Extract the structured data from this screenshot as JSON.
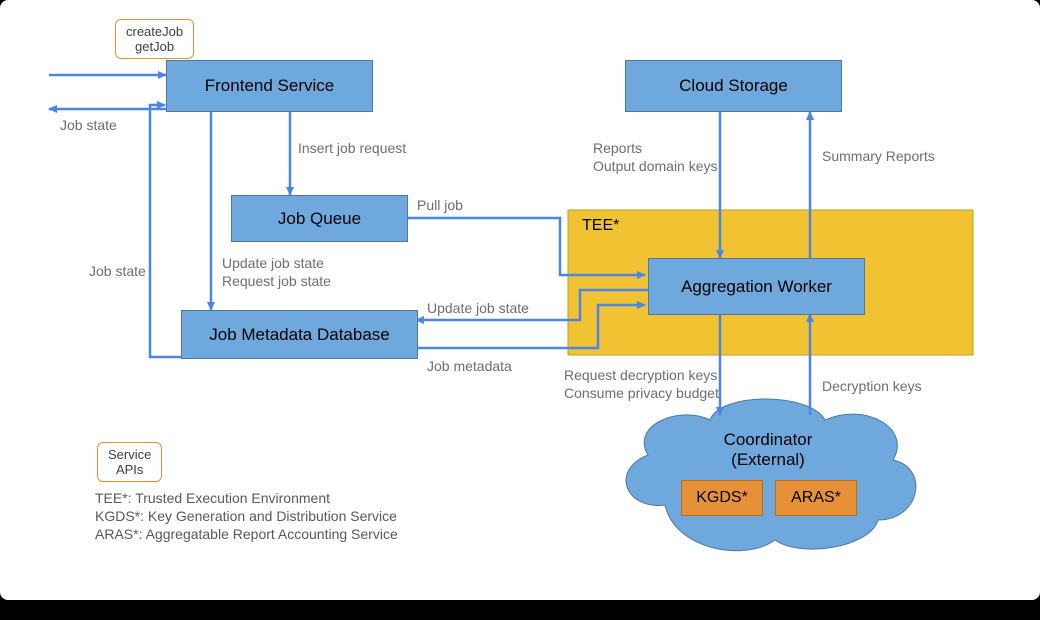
{
  "api_labels": {
    "top": {
      "line1": "createJob",
      "line2": "getJob"
    },
    "legend": {
      "line1": "Service",
      "line2": "APIs"
    }
  },
  "boxes": {
    "frontend": "Frontend Service",
    "cloud": "Cloud Storage",
    "queue": "Job Queue",
    "metadata": "Job Metadata Database",
    "worker": "Aggregation Worker",
    "tee": "TEE*"
  },
  "coordinator": {
    "title1": "Coordinator",
    "title2": "(External)",
    "kgds": "KGDS*",
    "aras": "ARAS*"
  },
  "labels": {
    "job_state_left": "Job state",
    "job_state_top": "Job state",
    "insert_job": "Insert job request",
    "pull_job": "Pull job",
    "update_and_request1": "Update job state",
    "update_and_request2": "Request job state",
    "update_job_state_right": "Update job state",
    "job_metadata": "Job metadata",
    "reports1": "Reports",
    "reports2": "Output domain keys",
    "summary": "Summary Reports",
    "request_keys1": "Request decryption keys",
    "request_keys2": "Consume privacy budget",
    "decryption": "Decryption keys"
  },
  "legend": {
    "tee": "TEE*: Trusted Execution Environment",
    "kgds": "KGDS*: Key Generation and Distribution Service",
    "aras": "ARAS*: Aggregatable Report Accounting Service"
  }
}
